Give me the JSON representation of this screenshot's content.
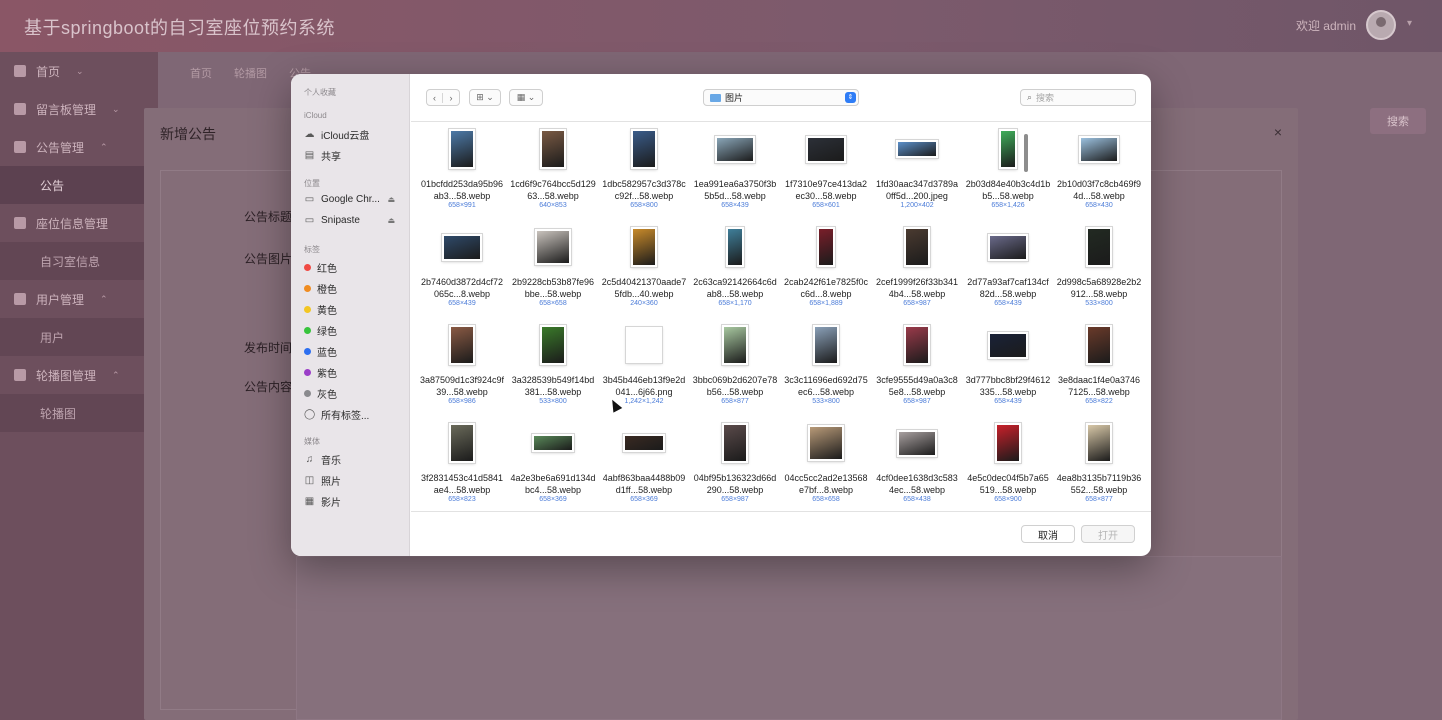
{
  "app": {
    "title": "基于springboot的自习室座位预约系统",
    "user_greeting": "欢迎 admin",
    "sidebar": [
      {
        "label": "首页",
        "type": "item"
      },
      {
        "label": "留言板管理",
        "type": "item"
      },
      {
        "label": "公告管理",
        "type": "item"
      },
      {
        "label": "公告",
        "type": "sub"
      },
      {
        "label": "座位信息管理",
        "type": "item"
      },
      {
        "label": "自习室信息",
        "type": "sub"
      },
      {
        "label": "用户管理",
        "type": "item"
      },
      {
        "label": "用户",
        "type": "sub"
      },
      {
        "label": "轮播图管理",
        "type": "item"
      },
      {
        "label": "轮播图",
        "type": "sub"
      }
    ],
    "tabs": [
      "首页",
      "轮播图",
      "公告"
    ],
    "search_button": "搜索"
  },
  "edit_dialog": {
    "title": "新增公告",
    "fields": [
      "公告标题",
      "公告图片",
      "发布时间",
      "公告内容"
    ]
  },
  "picker": {
    "sidebar": {
      "favorites_header": "个人收藏",
      "icloud_header": "iCloud",
      "icloud_items": [
        "iCloud云盘",
        "共享"
      ],
      "locations_header": "位置",
      "locations": [
        "Google Chr...",
        "Snipaste"
      ],
      "tags_header": "标签",
      "tags": [
        {
          "label": "红色",
          "color": "#f04a44"
        },
        {
          "label": "橙色",
          "color": "#f08c21"
        },
        {
          "label": "黄色",
          "color": "#f3c623"
        },
        {
          "label": "绿色",
          "color": "#38c43d"
        },
        {
          "label": "蓝色",
          "color": "#2d6ff0"
        },
        {
          "label": "紫色",
          "color": "#9b3ec8"
        },
        {
          "label": "灰色",
          "color": "#8a8a8e"
        }
      ],
      "all_tags": "所有标签...",
      "media_header": "媒体",
      "media": [
        "音乐",
        "照片",
        "影片"
      ]
    },
    "current_folder": "图片",
    "search_placeholder": "搜索",
    "cancel_label": "取消",
    "open_label": "打开",
    "files": [
      {
        "name": "01bcfdd253da95b96ab3...58.webp",
        "dims": "658×991",
        "c": "#4d7aa8",
        "o": "p"
      },
      {
        "name": "1cd6f9c764bcc5d12963...58.webp",
        "dims": "640×853",
        "c": "#7a5a44",
        "o": "p"
      },
      {
        "name": "1dbc582957c3d378cc92f...58.webp",
        "dims": "658×800",
        "c": "#3a5c8a",
        "o": "p"
      },
      {
        "name": "1ea991ea6a3750f3b5b5d...58.webp",
        "dims": "658×439",
        "c": "#8aa6b8",
        "o": "l"
      },
      {
        "name": "1f7310e97ce413da2ec30...58.webp",
        "dims": "658×601",
        "c": "#2c3038",
        "o": "l"
      },
      {
        "name": "1fd30aac347d3789a0ff5d...200.jpeg",
        "dims": "1,200×402",
        "c": "#5b8fc9",
        "o": "w"
      },
      {
        "name": "2b03d84e40b3c4d1bb5...58.webp",
        "dims": "658×1,426",
        "c": "#3fae5a",
        "o": "t"
      },
      {
        "name": "2b10d03f7c8cb469f94d...58.webp",
        "dims": "658×430",
        "c": "#9cc1df",
        "o": "l"
      },
      {
        "name": "2b7460d3872d4cf72065c...8.webp",
        "dims": "658×439",
        "c": "#2f4a6a",
        "o": "l"
      },
      {
        "name": "2b9228cb53b87fe96bbe...58.webp",
        "dims": "658×658",
        "c": "#c9c3bd",
        "o": "s"
      },
      {
        "name": "2c5d40421370aade75fdb...40.webp",
        "dims": "240×360",
        "c": "#c88a2a",
        "o": "p"
      },
      {
        "name": "2c63ca92142664c6dab8...58.webp",
        "dims": "658×1,170",
        "c": "#3f7f9a",
        "o": "t"
      },
      {
        "name": "2cab242f61e7825f0cc6d...8.webp",
        "dims": "658×1,889",
        "c": "#7a1e2a",
        "o": "t"
      },
      {
        "name": "2cef1999f26f33b3414b4...58.webp",
        "dims": "658×987",
        "c": "#4a3a30",
        "o": "p"
      },
      {
        "name": "2d77a93af7caf134cf82d...58.webp",
        "dims": "658×439",
        "c": "#6a6a8a",
        "o": "l"
      },
      {
        "name": "2d998c5a68928e2b2912...58.webp",
        "dims": "533×800",
        "c": "#222a22",
        "o": "p"
      },
      {
        "name": "3a87509d1c3f924c9f39...58.webp",
        "dims": "658×986",
        "c": "#8a5a44",
        "o": "p"
      },
      {
        "name": "3a328539b549f14bd381...58.webp",
        "dims": "533×800",
        "c": "#3a7a2a",
        "o": "p"
      },
      {
        "name": "3b45b446eb13f9e2d041...6j66.png",
        "dims": "1,242×1,242",
        "c": "#ffffff",
        "o": "s"
      },
      {
        "name": "3bbc069b2d6207e78b56...58.webp",
        "dims": "658×877",
        "c": "#a8c8a0",
        "o": "p"
      },
      {
        "name": "3c3c11696ed692d75ec6...58.webp",
        "dims": "533×800",
        "c": "#8aa0b8",
        "o": "p"
      },
      {
        "name": "3cfe9555d49a0a3c85e8...58.webp",
        "dims": "658×987",
        "c": "#9a3a4a",
        "o": "p"
      },
      {
        "name": "3d777bbc8bf29f4612335...58.webp",
        "dims": "658×439",
        "c": "#1a2238",
        "o": "l"
      },
      {
        "name": "3e8daac1f4e0a37467125...58.webp",
        "dims": "658×822",
        "c": "#6a3a2a",
        "o": "p"
      },
      {
        "name": "3f2831453c41d5841ae4...58.webp",
        "dims": "658×823",
        "c": "#6a6a5a",
        "o": "p"
      },
      {
        "name": "4a2e3be6a691d134dbc4...58.webp",
        "dims": "658×369",
        "c": "#5a8a5a",
        "o": "w"
      },
      {
        "name": "4abf863baa4488b09d1ff...58.webp",
        "dims": "658×369",
        "c": "#3a2a22",
        "o": "w"
      },
      {
        "name": "04bf95b136323d66d290...58.webp",
        "dims": "658×987",
        "c": "#5a4a4a",
        "o": "p"
      },
      {
        "name": "04cc5cc2ad2e13568e7bf...8.webp",
        "dims": "658×658",
        "c": "#b89a78",
        "o": "s"
      },
      {
        "name": "4cf0dee1638d3c5834ec...58.webp",
        "dims": "658×438",
        "c": "#a8a0a0",
        "o": "l"
      },
      {
        "name": "4e5c0dec04f5b7a65519...58.webp",
        "dims": "658×900",
        "c": "#c8202a",
        "o": "p"
      },
      {
        "name": "4ea8b3135b7119b36552...58.webp",
        "dims": "658×877",
        "c": "#d8c8a8",
        "o": "p"
      }
    ]
  }
}
